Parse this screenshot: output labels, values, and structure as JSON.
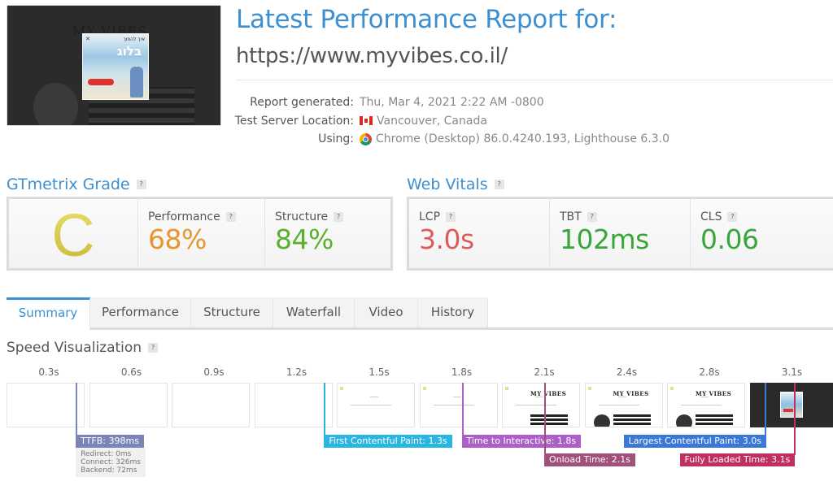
{
  "header": {
    "title": "Latest Performance Report for:",
    "url": "https://www.myvibes.co.il/",
    "screenshot": {
      "site_logo_text": "MY VIBES",
      "popup_small_text": "איך להפוך",
      "popup_big_text": "בלוג"
    },
    "meta": [
      {
        "label": "Report generated:",
        "value": "Thu, Mar 4, 2021 2:22 AM -0800",
        "icon": null
      },
      {
        "label": "Test Server Location:",
        "value": "Vancouver, Canada",
        "icon": "canada-flag-icon"
      },
      {
        "label": "Using:",
        "value": "Chrome (Desktop) 86.0.4240.193, Lighthouse 6.3.0",
        "icon": "chrome-icon"
      }
    ]
  },
  "help_glyph": "?",
  "grade": {
    "heading": "GTmetrix Grade",
    "letter": "C",
    "letter_color": "#d6c94a",
    "performance": {
      "label": "Performance",
      "value": "68%",
      "color": "#e8952e"
    },
    "structure": {
      "label": "Structure",
      "value": "84%",
      "color": "#5cb030"
    }
  },
  "vitals": {
    "heading": "Web Vitals",
    "lcp": {
      "label": "LCP",
      "value": "3.0s",
      "color": "#e05a5a"
    },
    "tbt": {
      "label": "TBT",
      "value": "102ms",
      "color": "#3aa63a"
    },
    "cls": {
      "label": "CLS",
      "value": "0.06",
      "color": "#3aa63a"
    }
  },
  "tabs": [
    {
      "label": "Summary",
      "active": true
    },
    {
      "label": "Performance",
      "active": false
    },
    {
      "label": "Structure",
      "active": false
    },
    {
      "label": "Waterfall",
      "active": false
    },
    {
      "label": "Video",
      "active": false
    },
    {
      "label": "History",
      "active": false
    }
  ],
  "speed_viz": {
    "title": "Speed Visualization",
    "frames": [
      {
        "time": "0.3s",
        "t": 0.3,
        "state": "blank"
      },
      {
        "time": "0.6s",
        "t": 0.6,
        "state": "blank"
      },
      {
        "time": "0.9s",
        "t": 0.9,
        "state": "blank"
      },
      {
        "time": "1.2s",
        "t": 1.2,
        "state": "blank"
      },
      {
        "time": "1.5s",
        "t": 1.5,
        "state": "partial"
      },
      {
        "time": "1.8s",
        "t": 1.8,
        "state": "partial"
      },
      {
        "time": "2.1s",
        "t": 2.1,
        "state": "loaded"
      },
      {
        "time": "2.4s",
        "t": 2.4,
        "state": "loaded"
      },
      {
        "time": "2.8s",
        "t": 2.8,
        "state": "loaded"
      },
      {
        "time": "3.1s",
        "t": 3.1,
        "state": "popup"
      }
    ],
    "markers": [
      {
        "name": "ttfb",
        "label": "TTFB: 398ms",
        "t": 0.398,
        "color": "#7b84b8",
        "row": 0,
        "details": [
          "Redirect: 0ms",
          "Connect: 326ms",
          "Backend: 72ms"
        ]
      },
      {
        "name": "fcp",
        "label": "First Contentful Paint: 1.3s",
        "t": 1.3,
        "color": "#29b6e0",
        "row": 0
      },
      {
        "name": "tti",
        "label": "Time to Interactive: 1.8s",
        "t": 1.8,
        "color": "#ad5fc8",
        "row": 0
      },
      {
        "name": "onload",
        "label": "Onload Time: 2.1s",
        "t": 2.1,
        "color": "#a0507a",
        "row": 1
      },
      {
        "name": "lcp",
        "label": "Largest Contentful Paint: 3.0s",
        "t": 3.0,
        "color": "#3a78d8",
        "row": 0
      },
      {
        "name": "fully-loaded",
        "label": "Fully Loaded Time: 3.1s",
        "t": 3.1,
        "color": "#c0305e",
        "row": 1
      }
    ]
  }
}
